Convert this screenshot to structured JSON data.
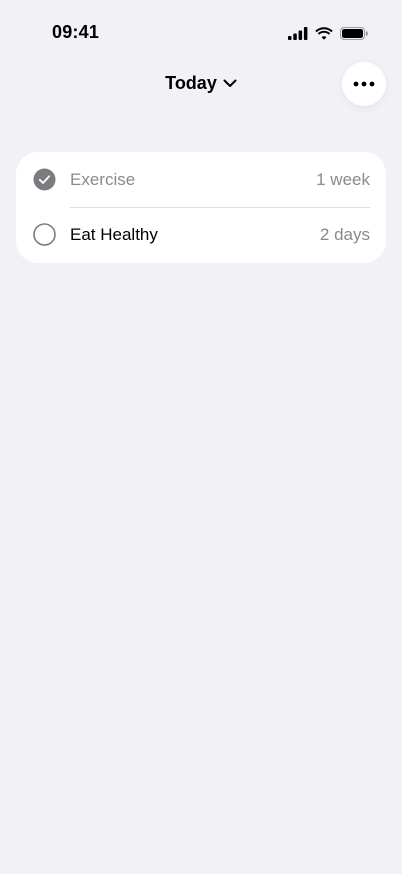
{
  "status_bar": {
    "time": "09:41"
  },
  "header": {
    "title": "Today",
    "title_icon": "chevron-down-icon",
    "more_icon": "ellipsis-icon"
  },
  "habits": [
    {
      "name": "Exercise",
      "meta": "1 week",
      "completed": true
    },
    {
      "name": "Eat Healthy",
      "meta": "2 days",
      "completed": false
    }
  ],
  "colors": {
    "background": "#f1f1f6",
    "card": "#ffffff",
    "muted_text": "#8a8a8e",
    "check_fill": "#7c7c80"
  }
}
